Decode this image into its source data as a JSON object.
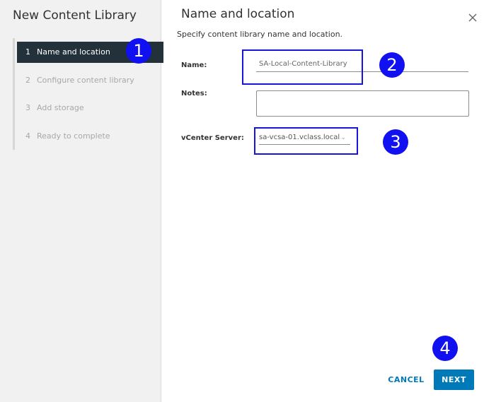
{
  "wizard": {
    "title": "New Content Library",
    "steps": [
      {
        "num": "1",
        "label": "Name and location",
        "active": true
      },
      {
        "num": "2",
        "label": "Configure content library",
        "active": false
      },
      {
        "num": "3",
        "label": "Add storage",
        "active": false
      },
      {
        "num": "4",
        "label": "Ready to complete",
        "active": false
      }
    ]
  },
  "page": {
    "title": "Name and location",
    "subtitle": "Specify content library name and location."
  },
  "form": {
    "name_label": "Name:",
    "name_value": "SA-Local-Content-Library",
    "notes_label": "Notes:",
    "notes_value": "",
    "server_label": "vCenter Server:",
    "server_value": "sa-vcsa-01.vclass.local"
  },
  "footer": {
    "cancel_label": "CANCEL",
    "next_label": "NEXT"
  },
  "callouts": [
    "1",
    "2",
    "3",
    "4"
  ],
  "colors": {
    "accent": "#0079b8",
    "active_step_bg": "#22313a",
    "callout": "#1010f0"
  },
  "icons": {
    "close": "close-icon",
    "dropdown": "chevron-down-icon"
  }
}
